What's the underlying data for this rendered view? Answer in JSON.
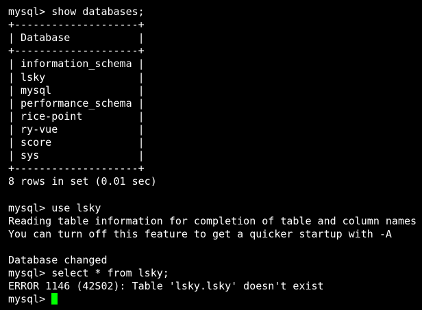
{
  "terminal": {
    "lines": [
      "mysql> show databases;",
      "+--------------------+",
      "| Database           |",
      "+--------------------+",
      "| information_schema |",
      "| lsky               |",
      "| mysql              |",
      "| performance_schema |",
      "| rice-point         |",
      "| ry-vue             |",
      "| score              |",
      "| sys                |",
      "+--------------------+",
      "8 rows in set (0.01 sec)",
      "",
      "mysql> use lsky",
      "Reading table information for completion of table and column names",
      "You can turn off this feature to get a quicker startup with -A",
      "",
      "Database changed",
      "mysql> select * from lsky;",
      "ERROR 1146 (42S02): Table 'lsky.lsky' doesn't exist"
    ],
    "prompt": "mysql> ",
    "cursor_color": "#00ff00"
  }
}
